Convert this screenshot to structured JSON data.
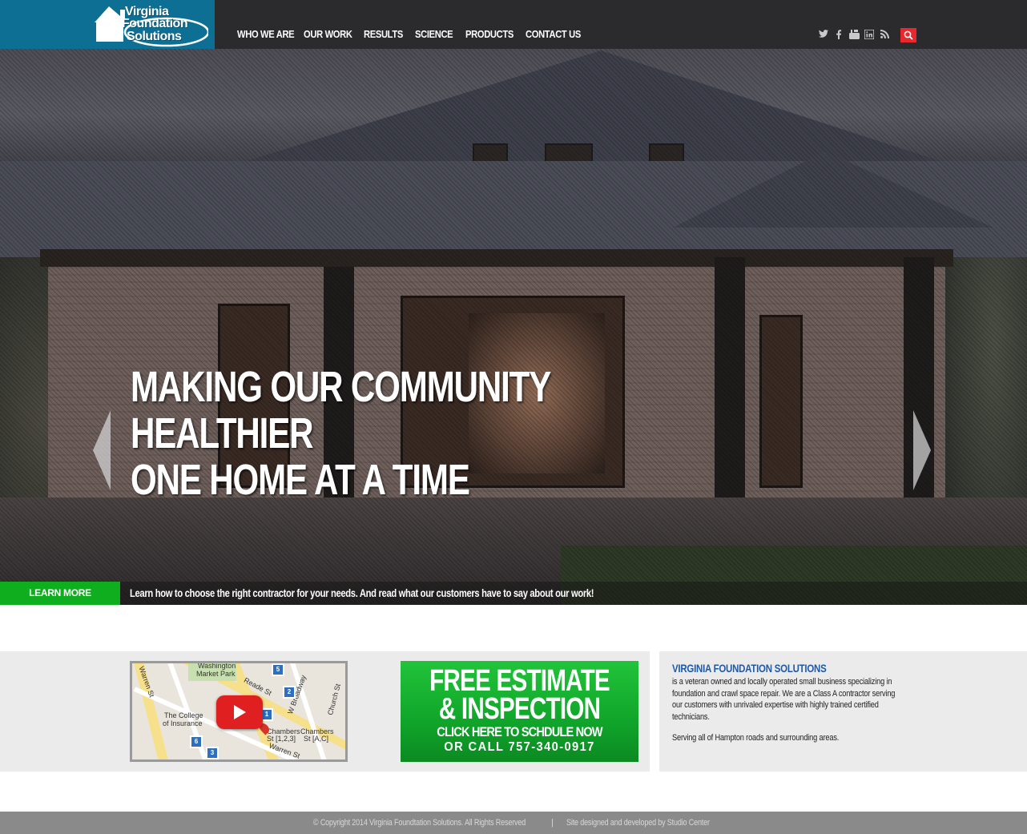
{
  "header": {
    "logo": {
      "line1": "Virginia",
      "line2": "Foundation",
      "line3": "Solutions"
    },
    "nav": [
      {
        "label": "WHO WE ARE"
      },
      {
        "label": "OUR WORK"
      },
      {
        "label": "RESULTS"
      },
      {
        "label": "SCIENCE"
      },
      {
        "label": "PRODUCTS"
      },
      {
        "label": "CONTACT US"
      }
    ],
    "social": [
      "twitter-icon",
      "facebook-icon",
      "youtube-icon",
      "linkedin-icon",
      "rss-icon"
    ],
    "search_icon": "search-icon"
  },
  "hero": {
    "title_lines": [
      "MAKING OUR COMMUNITY",
      "HEALTHIER",
      "ONE HOME AT A TIME"
    ],
    "learn_more_label": "LEARN MORE",
    "learn_more_text": "Learn how to choose the right contractor for your needs. And read what our customers have to say about our work!"
  },
  "map": {
    "labels": [
      "Washington",
      "Market Park",
      "Reade St",
      "W Broadway",
      "Church St",
      "Warren St",
      "The College",
      "of Insurance",
      "Chambers",
      "St [1,2,3]",
      "Chambers",
      "St [A,C]",
      "Warren St"
    ],
    "pins": [
      "5",
      "1",
      "2",
      "6",
      "3"
    ]
  },
  "estimate": {
    "line1": "FREE ESTIMATE",
    "line2": "& INSPECTION",
    "line3": "CLICK HERE TO SCHDULE NOW",
    "line4": "OR CALL 757-340-0917"
  },
  "about": {
    "title": "VIRGINIA FOUNDATION SOLUTIONS",
    "text": "is a veteran owned and locally operated small business specializing in foundation and crawl space repair. We are a Class A contractor serving our customers with unrivaled expertise with highly trained certified technicians.",
    "sub": "Serving all of Hampton roads and surrounding areas."
  },
  "footer": {
    "copyright": "© Copyright 2014 Virginia Foundtation Solutions. All Rights Reserved",
    "separator": "|",
    "credit": "Site designed and developed by Studio Center"
  },
  "colors": {
    "header_bg": "#2b2b2d",
    "logo_bg": "#0e6f95",
    "accent_green": "#0fae1f",
    "search_red": "#e8282c",
    "about_title": "#1f5aa8",
    "footer_bg": "#8a8a8a"
  }
}
